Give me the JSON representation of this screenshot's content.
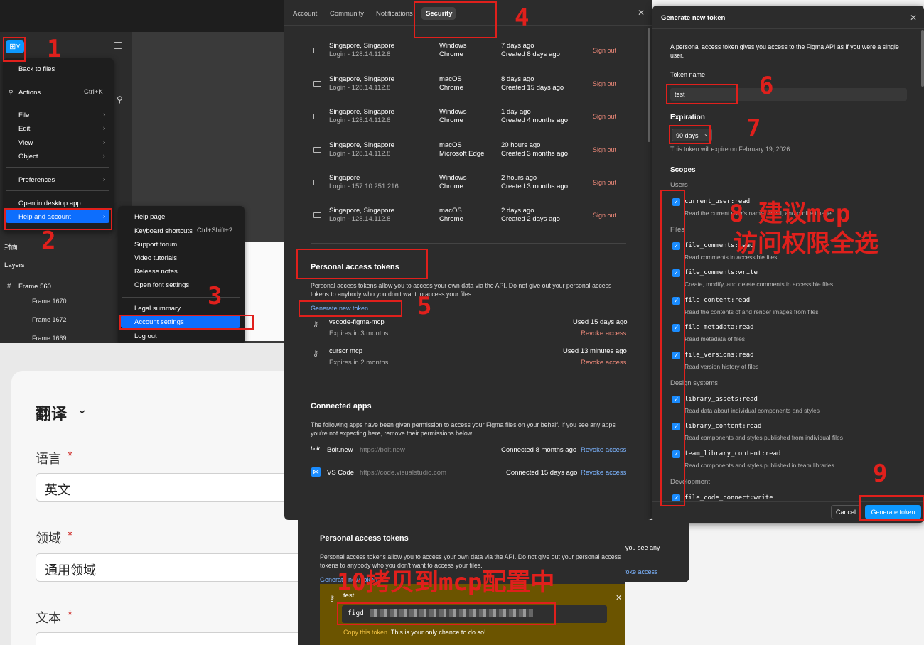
{
  "figma_menu": {
    "items": [
      "Back to files",
      "Actions...",
      "File",
      "Edit",
      "View",
      "Object",
      "Preferences",
      "Open in desktop app",
      "Help and account"
    ],
    "actions_shortcut": "Ctrl+K",
    "canvas_labels": {
      "cover": "封面",
      "layers": "Layers",
      "frame_main": "Frame 560",
      "frames": [
        "Frame 1670",
        "Frame 1672",
        "Frame 1669"
      ]
    },
    "help_submenu": [
      "Help page",
      "Keyboard shortcuts",
      "Support forum",
      "Video tutorials",
      "Release notes",
      "Open font settings",
      "Legal summary",
      "Account settings",
      "Log out"
    ],
    "keyboard_shortcut": "Ctrl+Shift+?"
  },
  "settings": {
    "tabs": [
      "Account",
      "Community",
      "Notifications",
      "Security"
    ],
    "sessions": [
      {
        "location": "Singapore, Singapore",
        "ip": "Login - 128.14.112.8",
        "os": "Windows",
        "browser": "Chrome",
        "last": "7 days ago",
        "created": "Created 8 days ago"
      },
      {
        "location": "Singapore, Singapore",
        "ip": "Login - 128.14.112.8",
        "os": "macOS",
        "browser": "Chrome",
        "last": "8 days ago",
        "created": "Created 15 days ago"
      },
      {
        "location": "Singapore, Singapore",
        "ip": "Login - 128.14.112.8",
        "os": "Windows",
        "browser": "Chrome",
        "last": "1 day ago",
        "created": "Created 4 months ago"
      },
      {
        "location": "Singapore, Singapore",
        "ip": "Login - 128.14.112.8",
        "os": "macOS",
        "browser": "Microsoft Edge",
        "last": "20 hours ago",
        "created": "Created 3 months ago"
      },
      {
        "location": "Singapore",
        "ip": "Login - 157.10.251.216",
        "os": "Windows",
        "browser": "Chrome",
        "last": "2 hours ago",
        "created": "Created 3 months ago"
      },
      {
        "location": "Singapore, Singapore",
        "ip": "Login - 128.14.112.8",
        "os": "macOS",
        "browser": "Chrome",
        "last": "2 days ago",
        "created": "Created 2 days ago"
      }
    ],
    "sign_out": "Sign out",
    "pat_title": "Personal access tokens",
    "pat_desc": "Personal access tokens allow you to access your own data via the API. Do not give out your personal access tokens to anybody who you don't want to access your files.",
    "generate_link": "Generate new token",
    "tokens": [
      {
        "name": "vscode-figma-mcp",
        "expires": "Expires in 3 months",
        "used": "Used 15 days ago"
      },
      {
        "name": "cursor mcp",
        "expires": "Expires in 2 months",
        "used": "Used 13 minutes ago"
      }
    ],
    "revoke": "Revoke access",
    "apps_title": "Connected apps",
    "apps_desc": "The following apps have been given permission to access your Figma files on your behalf. If you see any apps you're not expecting here, remove their permissions below.",
    "apps": [
      {
        "name": "Bolt.new",
        "url": "https://bolt.new",
        "connected": "Connected 8 months ago",
        "logo": "bolt"
      },
      {
        "name": "VS Code",
        "url": "https://code.visualstudio.com",
        "connected": "Connected 15 days ago",
        "logo": "vs-code-icon"
      }
    ]
  },
  "gen_token": {
    "title": "Generate new token",
    "desc": "A personal access token gives you access to the Figma API as if you were a single user.",
    "name_label": "Token name",
    "name_value": "test",
    "expiration_label": "Expiration",
    "expiration_value": "90 days",
    "expiration_note": "This token will expire on February 19, 2026.",
    "scopes_label": "Scopes",
    "groups": {
      "users": "Users",
      "files": "Files",
      "design": "Design systems",
      "dev": "Development"
    },
    "scopes": [
      {
        "name": "current_user:read",
        "desc": "Read the current user's name, email, and profile image"
      },
      {
        "name": "file_comments:read",
        "desc": "Read comments in accessible files"
      },
      {
        "name": "file_comments:write",
        "desc": "Create, modify, and delete comments in accessible files"
      },
      {
        "name": "file_content:read",
        "desc": "Read the contents of and render images from files"
      },
      {
        "name": "file_metadata:read",
        "desc": "Read metadata of files"
      },
      {
        "name": "file_versions:read",
        "desc": "Read version history of files"
      },
      {
        "name": "library_assets:read",
        "desc": "Read data about individual components and styles"
      },
      {
        "name": "library_content:read",
        "desc": "Read components and styles published from individual files"
      },
      {
        "name": "team_library_content:read",
        "desc": "Read components and styles published in team libraries"
      },
      {
        "name": "file_code_connect:write",
        "desc": ""
      }
    ],
    "cancel": "Cancel",
    "generate": "Generate token"
  },
  "token_result": {
    "title": "Personal access tokens",
    "desc": "Personal access tokens allow you to access your own data via the API. Do not give out your personal access tokens to anybody who you don't want to access your files.",
    "generate_link": "Generate new token",
    "behind_text_1": "you see any",
    "behind_text_2": "voke access",
    "token_name": "test",
    "token_value": "figd_",
    "copy_note": "Copy this token.",
    "copy_note_rest": " This is your only chance to do so!"
  },
  "form": {
    "title": "翻译",
    "lang_label": "语言",
    "lang_value": "英文",
    "domain_label": "领域",
    "domain_value": "通用领域",
    "text_label": "文本",
    "required": "*"
  },
  "annotations": {
    "n1": "1",
    "n2": "2",
    "n3": "3",
    "n4": "4",
    "n5": "5",
    "n6": "6",
    "n7": "7",
    "n8a": "8 建议mcp",
    "n8b": "访问权限全选",
    "n9": "9",
    "n10": "10拷贝到mcp配置中"
  }
}
